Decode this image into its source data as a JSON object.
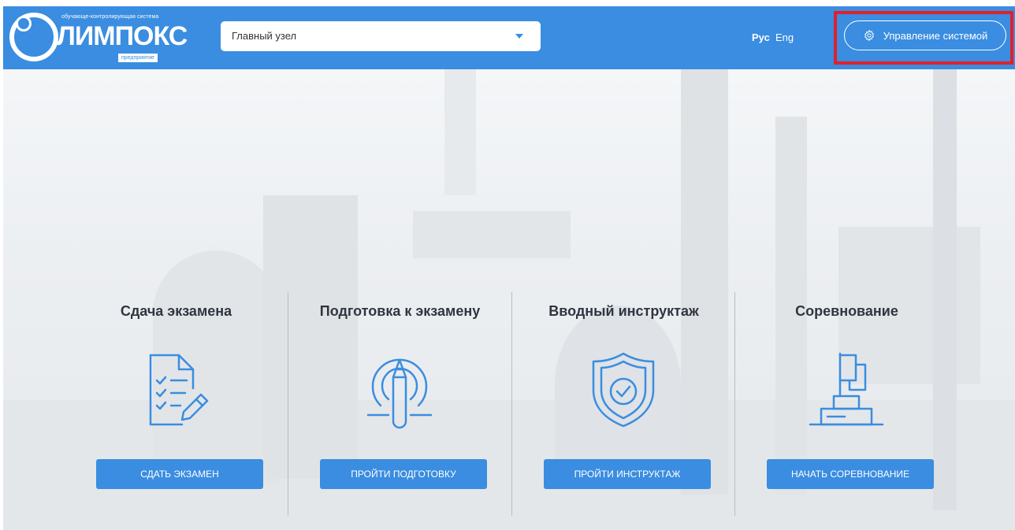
{
  "header": {
    "logo": {
      "top_text": "обучающе-контролирующая система",
      "main_text": "ЛИМПОКС",
      "sub_text": "предприятие"
    },
    "node_select": {
      "value": "Главный узел",
      "caret_icon": "caret-down-icon"
    },
    "languages": {
      "ru": "Рус",
      "en": "Eng",
      "active": "ru"
    },
    "system_button": {
      "label": "Управление системой",
      "icon": "gear-icon"
    }
  },
  "cards": [
    {
      "title": "Сдача экзамена",
      "icon": "checklist-document-icon",
      "button": "СДАТЬ ЭКЗАМЕН"
    },
    {
      "title": "Подготовка к экзамену",
      "icon": "pencil-target-icon",
      "button": "ПРОЙТИ ПОДГОТОВКУ"
    },
    {
      "title": "Вводный инструктаж",
      "icon": "shield-check-icon",
      "button": "ПРОЙТИ ИНСТРУКТАЖ"
    },
    {
      "title": "Соревнование",
      "icon": "podium-flag-icon",
      "button": "НАЧАТЬ СОРЕВНОВАНИЕ"
    }
  ],
  "colors": {
    "primary": "#3a8de0",
    "highlight": "#e0202a",
    "title": "#2f3640"
  }
}
